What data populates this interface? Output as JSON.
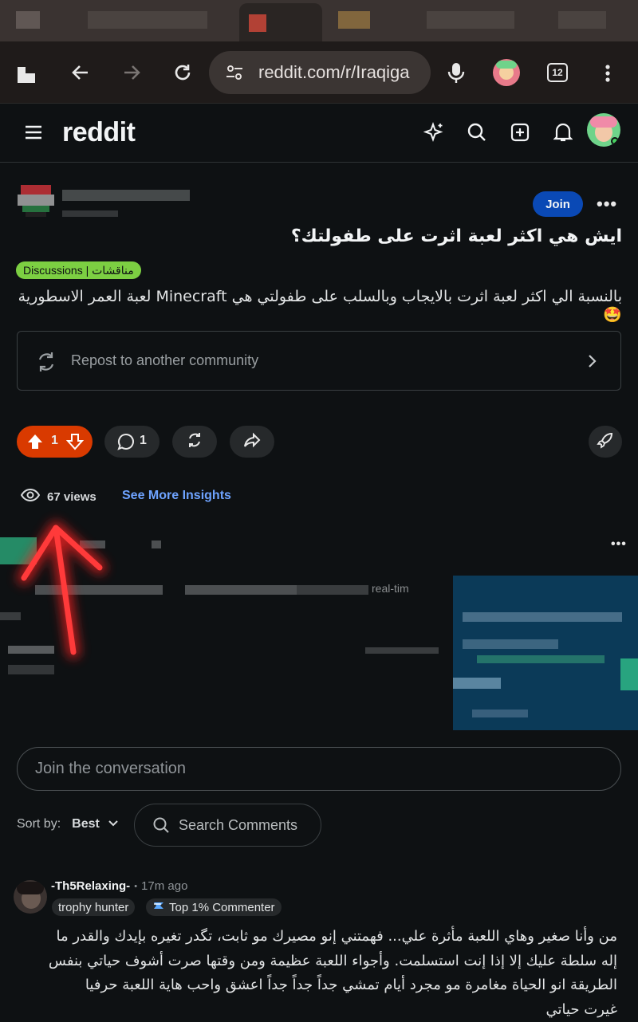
{
  "browser": {
    "url": "reddit.com/r/Iraqiga",
    "tab_count": "12"
  },
  "reddit_header": {
    "logo_text": "reddit"
  },
  "post": {
    "join_label": "Join",
    "title": "ايش هي اكثر لعبة اثرت على طفولتك؟",
    "flair": "Discussions | مناقشات",
    "body": "بالنسبة الي اكثر لعبة اثرت بالايجاب وبالسلب على طفولتي هي Minecraft لعبة العمر الاسطورية 🤩",
    "repost_label": "Repost to another community",
    "vote_count": "1",
    "comment_count": "1",
    "views": "67 views",
    "insights_label": "See More Insights"
  },
  "promo": {
    "partial_text": "real-tim"
  },
  "comments_section": {
    "join_placeholder": "Join the conversation",
    "sort_label": "Sort by:",
    "sort_value": "Best",
    "search_placeholder": "Search Comments"
  },
  "comment": {
    "author": "-Th5Relaxing-",
    "separator": "•",
    "time": "17m ago",
    "flair": "trophy hunter",
    "achievement": "Top 1% Commenter",
    "text": "من وأنا صغير وهاي اللعبة مأثرة علي... فهمتني إنو مصيرك مو ثابت، تگدر تغيره بإيدك والقدر ما إله سلطة عليك إلا إذا إنت استسلمت. وأجواء اللعبة عظيمة ومن وقتها صرت أشوف حياتي بنفس الطريقة انو الحياة مغامرة مو مجرد أيام تمشي جداً جداً جداً اعشق واحب هاية اللعبة حرفيا غيرت حياتي"
  },
  "colors": {
    "background": "#0e1113",
    "upvote_active": "#d93a00",
    "join_button": "#0a49b5",
    "flair": "#7ccf42",
    "link": "#6ea3ff",
    "annotation_arrow": "#ff2a2a"
  }
}
